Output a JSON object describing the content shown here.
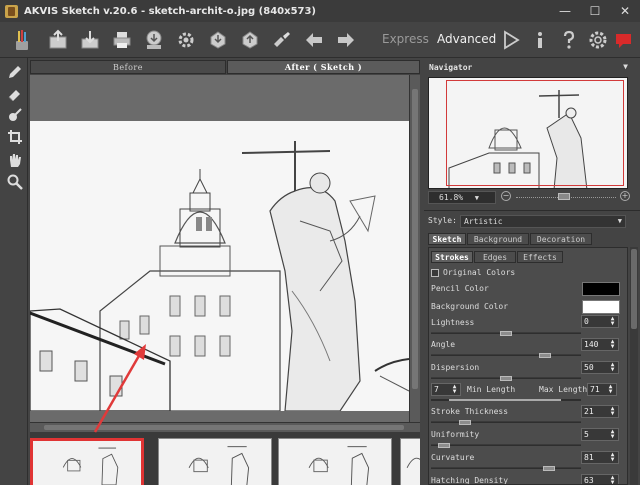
{
  "window": {
    "title": "AKVIS Sketch v.20.6 - sketch-archit-o.jpg (840x573)",
    "minimize": "—",
    "maximize": "☐",
    "close": "✕"
  },
  "toolbar": {
    "icons": [
      "logo-brush-icon",
      "open-image-icon",
      "save-image-icon",
      "print-icon",
      "share-icon",
      "preferences-gear-icon",
      "load-preset-icon",
      "save-preset-icon",
      "batch-icon",
      "undo-icon",
      "redo-icon"
    ],
    "express_label": "Express",
    "advanced_label": "Advanced",
    "right_icons": [
      "run-play-icon",
      "info-icon",
      "help-icon",
      "settings-gear-icon",
      "notification-icon"
    ]
  },
  "tools": [
    "pencil-icon",
    "eraser-icon",
    "smudge-icon",
    "crop-icon",
    "hand-icon",
    "zoom-icon"
  ],
  "view_tabs": {
    "before": "Before",
    "after": "After ( Sketch )"
  },
  "filmstrip": {
    "count": 4,
    "selected_index": 0
  },
  "navigator": {
    "title": "Navigator",
    "zoom": "61.8%",
    "zoom_fraction": 0.5
  },
  "style": {
    "label": "Style:",
    "value": "Artistic"
  },
  "main_tabs": [
    "Sketch",
    "Background",
    "Decoration"
  ],
  "inner_tabs": [
    "Strokes",
    "Edges",
    "Effects"
  ],
  "params": {
    "original_colors": "Original Colors",
    "pencil_color": "Pencil Color",
    "pencil_color_value": "#000000",
    "background_color": "Background Color",
    "background_color_value": "#ffffff",
    "lightness": {
      "label": "Lightness",
      "value": "0",
      "fraction": 0.5
    },
    "angle": {
      "label": "Angle",
      "value": "140",
      "fraction": 0.78
    },
    "dispersion": {
      "label": "Dispersion",
      "value": "50",
      "fraction": 0.5
    },
    "length": {
      "min_label": "Min Length",
      "min_value": "7",
      "max_label": "Max Length",
      "max_value": "71"
    },
    "stroke_thickness": {
      "label": "Stroke Thickness",
      "value": "21",
      "fraction": 0.2
    },
    "uniformity": {
      "label": "Uniformity",
      "value": "5",
      "fraction": 0.05
    },
    "curvature": {
      "label": "Curvature",
      "value": "81",
      "fraction": 0.81
    },
    "hatching_density": {
      "label": "Hatching Density",
      "value": "63"
    }
  }
}
